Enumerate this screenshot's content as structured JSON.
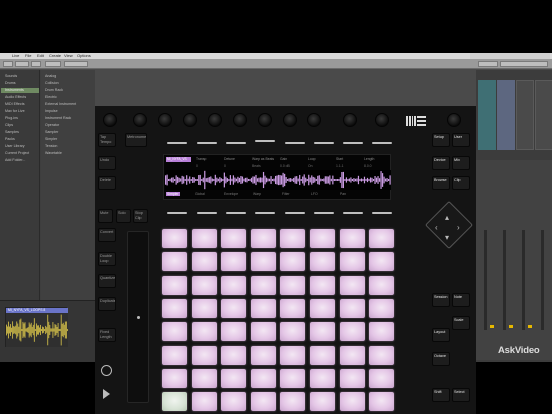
{
  "mac_menu": [
    "Live",
    "File",
    "Edit",
    "Create",
    "View",
    "Options",
    "Help"
  ],
  "browser": {
    "places": [
      "Sounds",
      "Drums",
      "Instruments",
      "Audio Effects",
      "MIDI Effects",
      "Max for Live",
      "Plug-ins",
      "Clips",
      "Samples",
      "Packs",
      "User Library",
      "Current Project",
      "Add Folder..."
    ],
    "selected_place": "Instruments",
    "items": [
      "Analog",
      "Collision",
      "Drum Rack",
      "Electric",
      "External Instrument",
      "Impulse",
      "Instrument Rack",
      "Operator",
      "Sampler",
      "Simpler",
      "Tension",
      "Wavetable"
    ]
  },
  "detail_clip": {
    "name": "MI_NYFA_VS_LOOPS 8"
  },
  "push": {
    "left_buttons": [
      "Tap Tempo",
      "Metronome",
      "Undo",
      "Delete",
      "Mute",
      "Solo",
      "Stop Clip",
      "Convert",
      "Double Loop",
      "Quantize",
      "Duplicate",
      "Fixed Length"
    ],
    "right_buttons": [
      "Setup",
      "User",
      "Device",
      "Mix",
      "Browse",
      "Clip",
      "Session",
      "Note",
      "Scale",
      "Layout",
      "Octave",
      "Shift",
      "Select"
    ],
    "display": {
      "track_tag": "MI_NYFA_VS",
      "header_labels": [
        "Transp",
        "Detune",
        "Warp as Beats",
        "Gain",
        "Loop",
        "Start",
        "Length"
      ],
      "header_values": [
        "0",
        "0",
        "Beats",
        "0.0 dB",
        "On",
        "1.1.1",
        "8.0.0"
      ],
      "footer_labels": [
        "Simpler",
        "Global",
        "Envelope",
        "Warp",
        "Filter",
        "LFO",
        "Pan"
      ],
      "active_footer": "Simpler"
    }
  },
  "watermark": "AskVideo"
}
